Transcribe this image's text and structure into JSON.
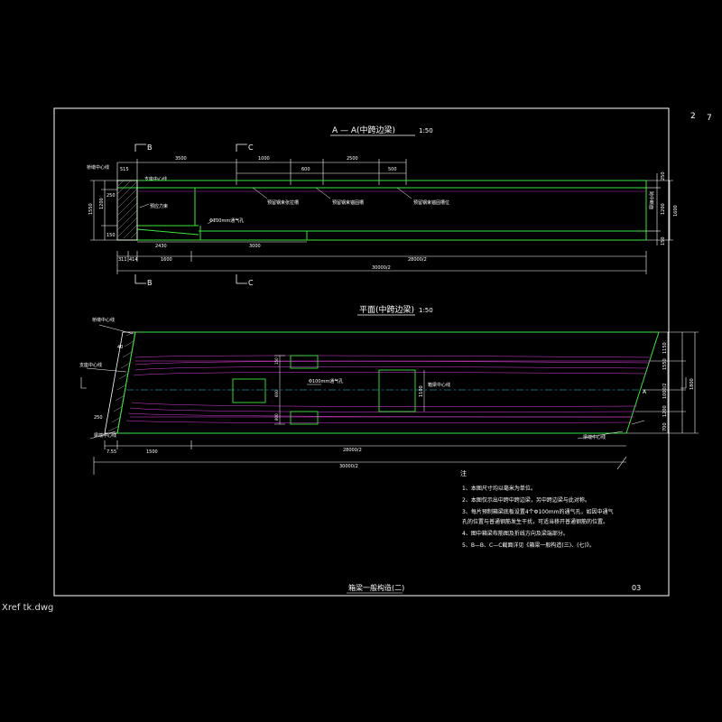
{
  "file": {
    "name": "Xref tk.dwg"
  },
  "sheet": {
    "page_number": "2",
    "page_mark": "7",
    "title": "箱梁一般构造(二)",
    "stamp": "03"
  },
  "colors": {
    "background": "#000000",
    "green": "#39e639",
    "white": "#ffffff",
    "magenta": "#e040e0",
    "cyan": "#30c0ff",
    "yellow": "#ffff00",
    "red": "#ff3030"
  },
  "section_aa": {
    "title": "A — A(中跨边梁)",
    "scale": "1:50",
    "cut_bb": "B",
    "cut_cc": "C",
    "top_dims": [
      "515",
      "3500",
      "1000",
      "600",
      "2500",
      "500"
    ],
    "mid_dims": [
      "2430",
      "3000"
    ],
    "bottom_dims": [
      "311",
      "414",
      "1600",
      "28000/2"
    ],
    "total_dim": "30000/2",
    "left_dims": [
      "1550",
      "250",
      "150",
      "150",
      "1200",
      "150"
    ],
    "right_dims": [
      "250",
      "1200",
      "1600",
      "150"
    ],
    "right_label": "跨中断面",
    "labels": [
      "桥墩中心线",
      "支座中心线",
      "预留钢束张拉槽",
      "预留钢束锚固槽",
      "预留钢束锚固槽位",
      "Φ100mm通气孔",
      "预应力束"
    ]
  },
  "plan": {
    "title": "平面(中跨边梁)",
    "scale": "1:50",
    "dims_top": [
      "150",
      "600"
    ],
    "dims_left": [
      "40",
      "250"
    ],
    "dims_bottom": [
      "7.55",
      "1500",
      "28000/2"
    ],
    "total_dim": "30000/2",
    "right_dims": [
      "1150",
      "1550",
      "1000/2",
      "1200",
      "700",
      "1800"
    ],
    "labels": [
      "桥墩中心线",
      "支座中心线",
      "梁端中心线",
      "Φ100mm通气孔",
      "箱梁中心线",
      "梁端中心线",
      "1100",
      "800"
    ]
  },
  "notes": {
    "heading": "注",
    "items": [
      "1、本图尺寸均以毫米为单位。",
      "2、本图仅示出中跨中跨边梁，另中跨边梁与此对称。",
      "3、每片预制箱梁底板设置4个Φ100mm的通气孔，如因中通气",
      "   孔的位置与普通钢筋发生干扰，可适当移开普通钢筋的位置。",
      "4、图中箱梁布筋图及折线方向及梁端部分。",
      "5、B—B、C—C截面详见《箱梁一般构造(三)、(七)》。"
    ]
  }
}
